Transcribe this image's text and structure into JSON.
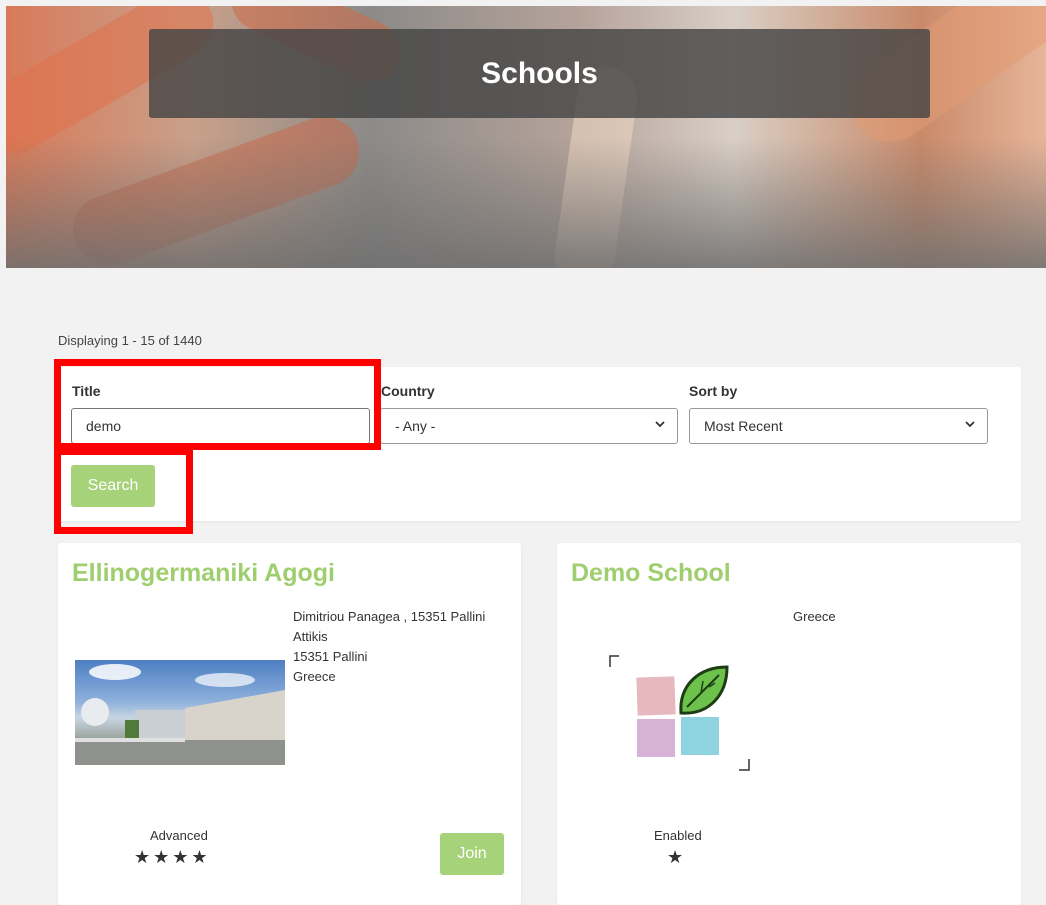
{
  "hero": {
    "title": "Schools"
  },
  "results": {
    "count_text": "Displaying 1 - 15 of 1440"
  },
  "filters": {
    "title_label": "Title",
    "title_value": "demo",
    "country_label": "Country",
    "country_value": "- Any -",
    "sort_label": "Sort by",
    "sort_value": "Most Recent",
    "search_label": "Search"
  },
  "cards": [
    {
      "name": "Ellinogermaniki Agogi",
      "address_lines": [
        "Dimitriou Panagea , 15351 Pallini",
        "Attikis",
        "15351 Pallini",
        "Greece"
      ],
      "level": "Advanced",
      "stars": "★★★★",
      "stars_count": 4,
      "join_label": "Join",
      "image": "school-building-photo"
    },
    {
      "name": "Demo School",
      "country": "Greece",
      "level": "Enabled",
      "stars": "★",
      "stars_count": 1,
      "image": "school-logo-leaf"
    }
  ],
  "colors": {
    "accent_green": "#a6d27a",
    "title_green": "#9fce6e",
    "highlight_red": "#ff0000"
  }
}
